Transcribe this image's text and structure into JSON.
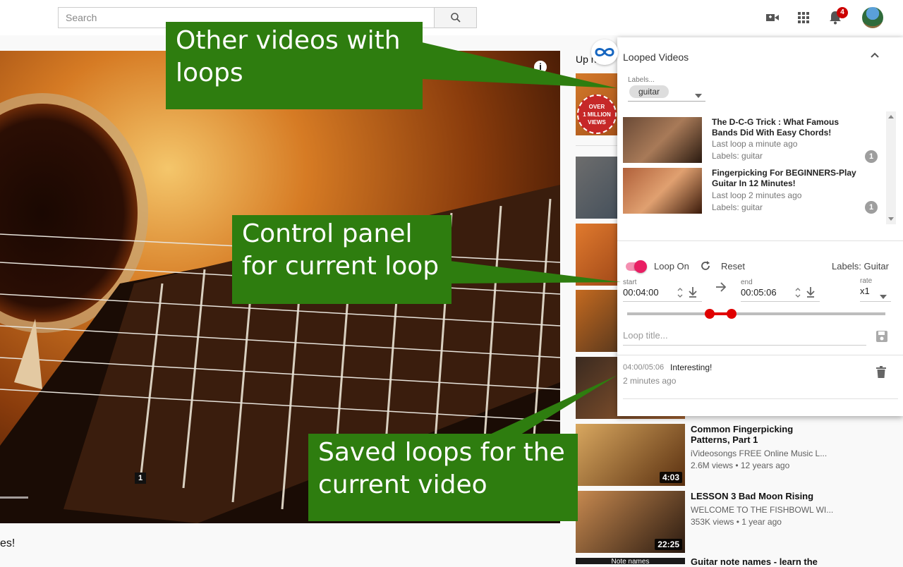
{
  "search": {
    "placeholder": "Search"
  },
  "topbar": {
    "notification_count": "4"
  },
  "player": {
    "counter": "1",
    "info": "i"
  },
  "below_video": {
    "text": "es!"
  },
  "sidebar": {
    "up_next": "Up n",
    "related": [
      {
        "title": "Common Fingerpicking Patterns, Part 1",
        "channel": "iVideosongs FREE Online Music L...",
        "meta": "2.6M views • 12 years ago",
        "duration": "4:03"
      },
      {
        "title": "LESSON 3 Bad Moon Rising",
        "channel": "WELCOME TO THE FISHBOWL WI...",
        "meta": "353K views • 1 year ago",
        "duration": "22:25"
      },
      {
        "title": "Guitar note names - learn the",
        "thumb_text": "Note names"
      }
    ],
    "thumb_badge": {
      "over": "OVER",
      "million": "1 MILLION",
      "views": "VIEWS"
    }
  },
  "panel": {
    "title": "Looped Videos",
    "labels_caption": "Labels...",
    "label_chip": "guitar",
    "videos": [
      {
        "title": "The D-C-G Trick : What Famous Bands Did With Easy Chords!",
        "last_loop": "Last loop a minute ago",
        "labels": "Labels: guitar",
        "count": "1"
      },
      {
        "title": "Fingerpicking For BEGINNERS-Play Guitar In 12 Minutes!",
        "last_loop": "Last loop 2 minutes ago",
        "labels": "Labels: guitar",
        "count": "1"
      }
    ],
    "controls": {
      "loop_on": "Loop On",
      "reset": "Reset",
      "labels": "Labels: Guitar",
      "start_caption": "start",
      "start_value": "00:04:00",
      "end_caption": "end",
      "end_value": "00:05:06",
      "rate_caption": "rate",
      "rate_value": "x1",
      "loop_title_placeholder": "Loop title..."
    },
    "saved_loop": {
      "range": "04:00/05:06",
      "title": "Interesting!",
      "time": "2 minutes ago"
    }
  },
  "callouts": {
    "other_videos": "Other videos with loops",
    "control_panel": "Control panel for current loop",
    "saved_loops": "Saved loops for the current video"
  }
}
